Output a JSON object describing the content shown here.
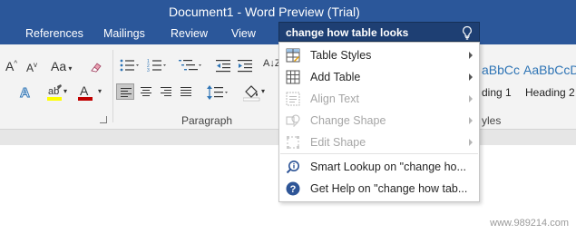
{
  "window": {
    "title": "Document1 - Word Preview (Trial)"
  },
  "ribbon_tabs": [
    "References",
    "Mailings",
    "Review",
    "View"
  ],
  "tell_me": {
    "query": "change how table looks",
    "icon": "lightbulb-icon"
  },
  "ribbon": {
    "paragraph_label": "Paragraph",
    "styles_label_partial": "yles",
    "styles": [
      {
        "preview": "aBbCc",
        "name": "ding 1"
      },
      {
        "preview": "AaBbCcD",
        "name": "Heading 2"
      }
    ],
    "font_case_label": "Aa",
    "font_grow_label": "A",
    "font_shrink_label": "A",
    "sort_label": "A↓Z"
  },
  "menu": {
    "items": [
      {
        "label": "Table Styles",
        "icon": "table-styles-icon",
        "disabled": false,
        "submenu": true
      },
      {
        "label": "Add Table",
        "icon": "table-grid-icon",
        "disabled": false,
        "submenu": true
      },
      {
        "label": "Align Text",
        "icon": "align-text-icon",
        "disabled": true,
        "submenu": true
      },
      {
        "label": "Change Shape",
        "icon": "change-shape-icon",
        "disabled": true,
        "submenu": true
      },
      {
        "label": "Edit Shape",
        "icon": "edit-shape-icon",
        "disabled": true,
        "submenu": true
      }
    ],
    "help_items": [
      {
        "label": "Smart Lookup on \"change ho...",
        "icon": "smart-lookup-icon"
      },
      {
        "label": "Get Help on \"change how tab...",
        "icon": "help-icon"
      }
    ]
  },
  "watermark": "www.989214.com",
  "colors": {
    "title_bar": "#2b579a",
    "search_box": "#1e3f73",
    "highlight_yellow": "#ffff00",
    "font_red": "#c00000",
    "accent_blue": "#2e74b5"
  }
}
